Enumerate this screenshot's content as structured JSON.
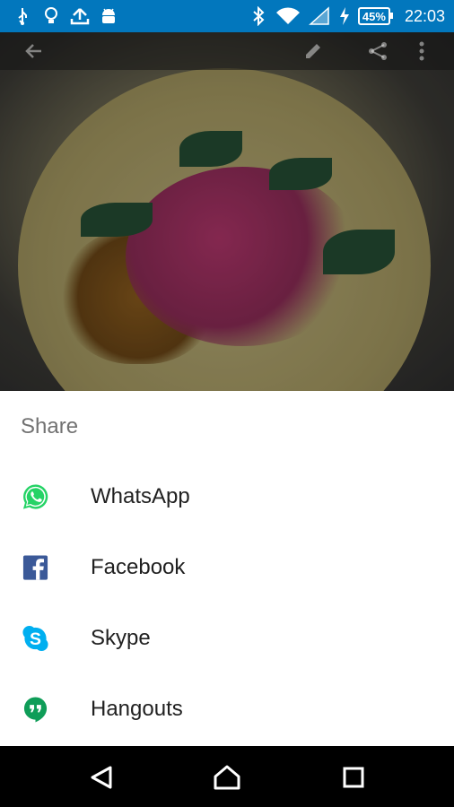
{
  "status_bar": {
    "battery": "45%",
    "time": "22:03"
  },
  "share": {
    "title": "Share",
    "items": [
      {
        "label": "WhatsApp",
        "icon": "whatsapp-icon",
        "color": "#25d366"
      },
      {
        "label": "Facebook",
        "icon": "facebook-icon",
        "color": "#3b5998"
      },
      {
        "label": "Skype",
        "icon": "skype-icon",
        "color": "#00aff0"
      },
      {
        "label": "Hangouts",
        "icon": "hangouts-icon",
        "color": "#0f9d58"
      }
    ]
  },
  "colors": {
    "status_bar": "#0277bd",
    "sheet_bg": "#ffffff"
  }
}
